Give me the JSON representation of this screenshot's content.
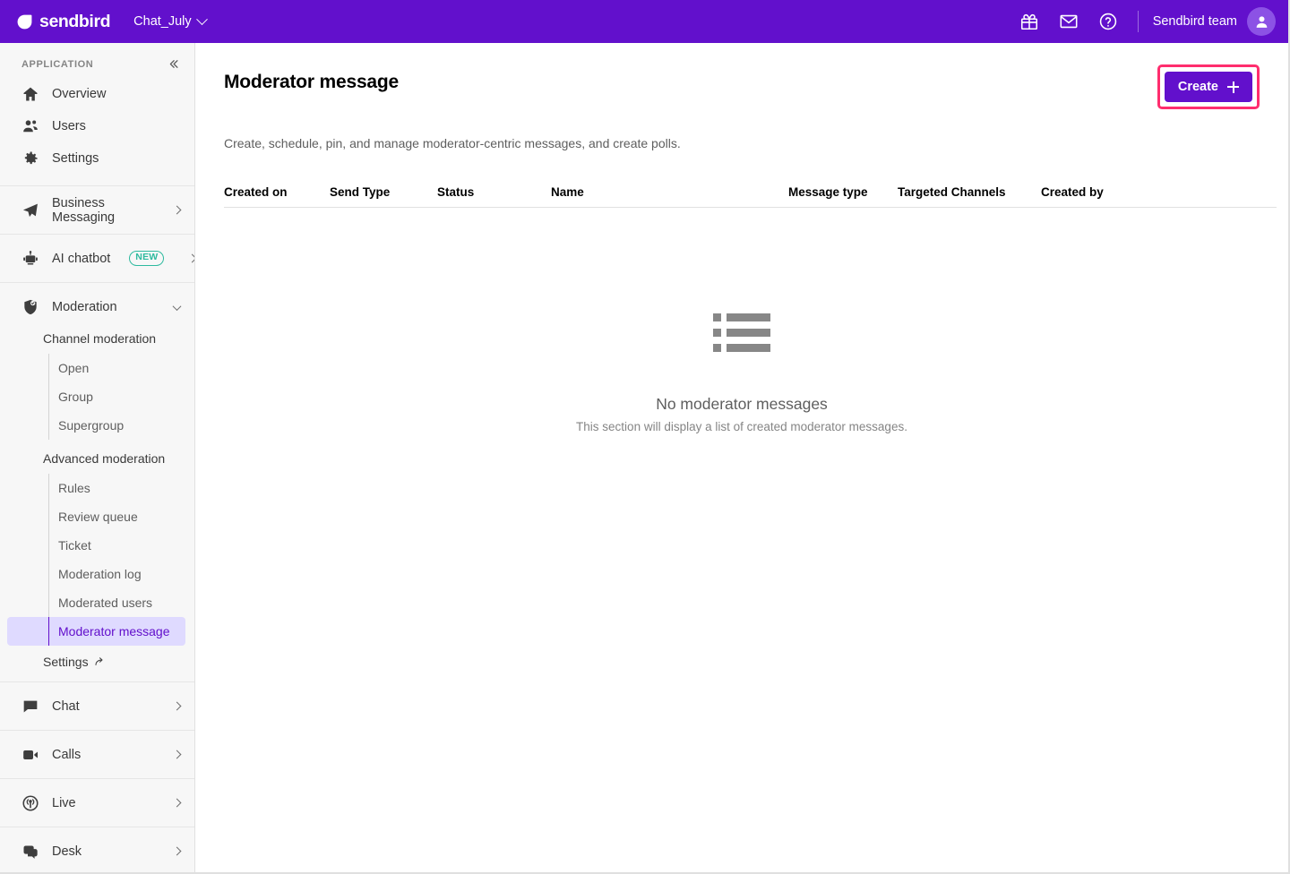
{
  "topbar": {
    "brand": "sendbird",
    "brand_icon": "sendbird-logo-icon",
    "app_name": "Chat_July",
    "gift_icon": "gift-icon",
    "mail_icon": "mail-icon",
    "help_icon": "help-circle-icon",
    "team_name": "Sendbird team",
    "avatar_icon": "user-avatar-icon",
    "brand_color": "#6210CC"
  },
  "sidebar": {
    "section_title": "APPLICATION",
    "collapse_icon": "chevron-double-left-icon",
    "app_items": [
      {
        "label": "Overview",
        "icon": "home-icon"
      },
      {
        "label": "Users",
        "icon": "users-icon"
      },
      {
        "label": "Settings",
        "icon": "gear-icon"
      }
    ],
    "product_items": [
      {
        "label": "Business Messaging",
        "icon": "send-icon",
        "chevron": "chevron-right-icon"
      },
      {
        "label": "AI chatbot",
        "icon": "robot-icon",
        "badge": "NEW",
        "chevron": "chevron-right-icon"
      }
    ],
    "moderation": {
      "label": "Moderation",
      "icon": "shield-check-icon",
      "chevron": "chevron-down-icon",
      "groups": [
        {
          "label": "Channel moderation",
          "items": [
            "Open",
            "Group",
            "Supergroup"
          ]
        },
        {
          "label": "Advanced moderation",
          "items": [
            "Rules",
            "Review queue",
            "Ticket",
            "Moderation log",
            "Moderated users",
            "Moderator message"
          ]
        }
      ],
      "active_item": "Moderator message",
      "active_bg": "#DFDAFF",
      "active_color": "#6210CC",
      "settings_link": "Settings",
      "settings_link_icon": "external-link-arrow-icon"
    },
    "bottom_items": [
      {
        "label": "Chat",
        "icon": "chat-bubble-icon",
        "chevron": "chevron-right-icon"
      },
      {
        "label": "Calls",
        "icon": "video-camera-icon",
        "chevron": "chevron-right-icon"
      },
      {
        "label": "Live",
        "icon": "broadcast-icon",
        "chevron": "chevron-right-icon"
      },
      {
        "label": "Desk",
        "icon": "desk-bubbles-icon",
        "chevron": "chevron-right-icon"
      }
    ]
  },
  "main": {
    "title": "Moderator message",
    "description": "Create, schedule, pin, and manage moderator-centric messages, and create polls.",
    "create_button": {
      "label": "Create",
      "icon": "plus-icon",
      "highlight_color": "#FF2D6E"
    },
    "table": {
      "columns": [
        "Created on",
        "Send Type",
        "Status",
        "Name",
        "Message type",
        "Targeted Channels",
        "Created by"
      ]
    },
    "empty_state": {
      "icon": "list-placeholder-icon",
      "title": "No moderator messages",
      "subtitle": "This section will display a list of created moderator messages."
    }
  }
}
